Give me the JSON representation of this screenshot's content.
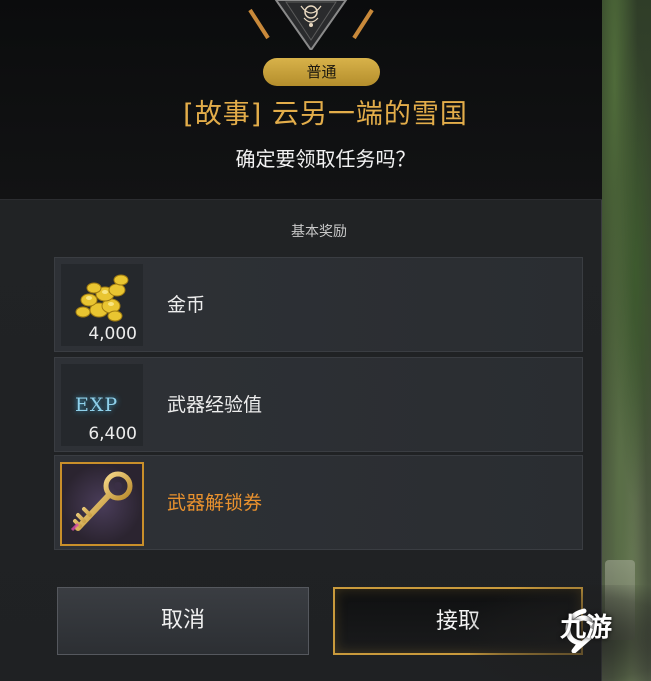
{
  "quest": {
    "badge": "普通",
    "title": "[故事] 云另一端的雪国",
    "confirm": "确定要领取任务吗？"
  },
  "rewards": {
    "heading": "基本奖励",
    "items": [
      {
        "name": "金币",
        "quantity": "4,000",
        "icon": "gold-coins-icon"
      },
      {
        "name": "武器经验值",
        "quantity": "6,400",
        "icon": "exp-icon",
        "icon_text": "EXP"
      },
      {
        "name": "武器解锁券",
        "quantity": "",
        "icon": "golden-key-icon"
      }
    ]
  },
  "buttons": {
    "cancel": "取消",
    "accept": "接取"
  },
  "watermark": {
    "text": "九游",
    "icon": "jiuyou-logo-icon"
  },
  "colors": {
    "quest_title": "#e3ad4a",
    "badge": "#c9a23e",
    "highlight_item": "#e8912e",
    "accept_border": "#c99a3c"
  }
}
